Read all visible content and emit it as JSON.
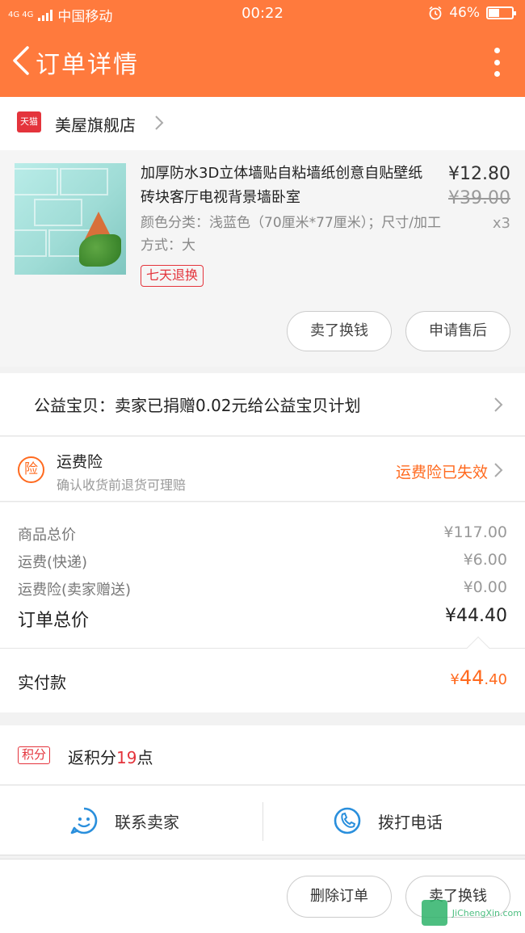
{
  "statusbar": {
    "network": "4G 4G",
    "carrier": "中国移动",
    "time": "00:22",
    "battery": "46%",
    "battery_level": 0.46
  },
  "header": {
    "title": "订单详情"
  },
  "store": {
    "platform_badge": "天猫",
    "name": "美屋旗舰店"
  },
  "product": {
    "name": "加厚防水3D立体墙贴自粘墙纸创意自贴壁纸砖块客厅电视背景墙卧室",
    "spec": "颜色分类：浅蓝色（70厘米*77厘米）；尺寸/加工方式：大",
    "badge": "七天退换",
    "price": "¥12.80",
    "original_price": "¥39.00",
    "quantity": "x3",
    "buttons": [
      "卖了换钱",
      "申请售后"
    ]
  },
  "charity": {
    "text": "公益宝贝：卖家已捐赠0.02元给公益宝贝计划"
  },
  "insurance": {
    "icon_text": "险",
    "title": "运费险",
    "desc": "确认收货前退货可理赔",
    "status": "运费险已失效"
  },
  "summary": {
    "rows": [
      {
        "label": "商品总价",
        "value": "¥117.00"
      },
      {
        "label": "运费(快递)",
        "value": "¥6.00"
      },
      {
        "label": "运费险(卖家赠送)",
        "value": "¥0.00"
      }
    ],
    "total_label": "订单总价",
    "total_value": "¥44.40"
  },
  "paid": {
    "label": "实付款",
    "currency": "¥",
    "integer": "44",
    "decimal": ".40"
  },
  "points": {
    "tag": "积分",
    "prefix": "返积分",
    "count": "19",
    "suffix": "点"
  },
  "contact": {
    "seller": "联系卖家",
    "call": "拨打电话"
  },
  "actions": {
    "delete": "删除订单",
    "resell": "卖了换钱"
  },
  "watermark": {
    "text": "JiChengXin.com"
  },
  "colors": {
    "header": "#ff7a3d",
    "accent": "#ff6a1f",
    "tmall": "#e4343c",
    "link_blue": "#2a8fdc"
  }
}
